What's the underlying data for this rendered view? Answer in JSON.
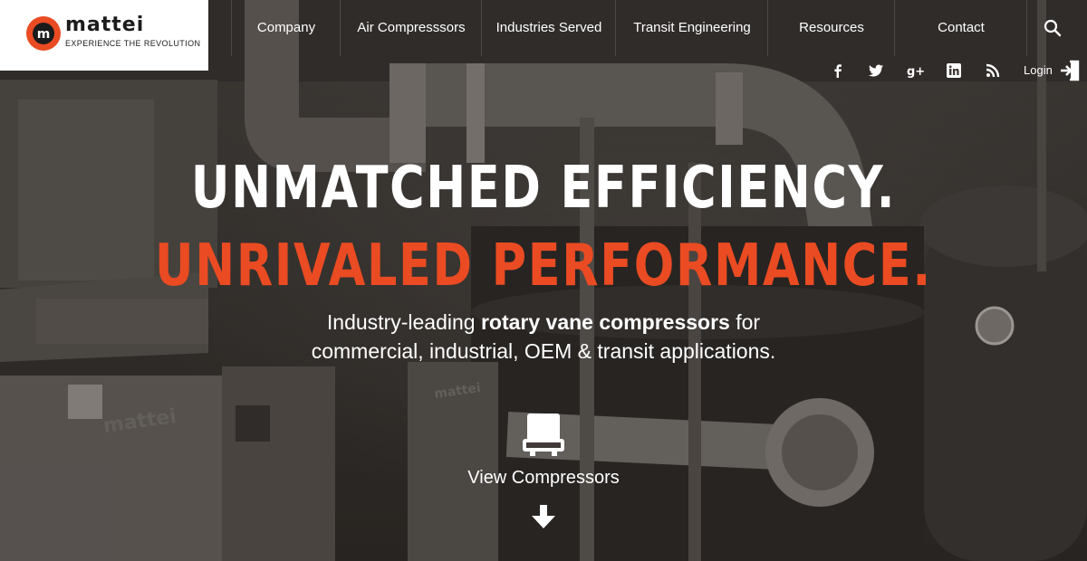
{
  "logo": {
    "wordmark": "mattei",
    "tagline": "EXPERIENCE THE REVOLUTION",
    "brand_color": "#ea4b22"
  },
  "nav": {
    "items": [
      {
        "label": "Company"
      },
      {
        "label": "Air Compresssors"
      },
      {
        "label": "Industries Served"
      },
      {
        "label": "Transit Engineering"
      },
      {
        "label": "Resources"
      },
      {
        "label": "Contact"
      }
    ],
    "search_icon": "search-icon"
  },
  "social": {
    "icons": [
      "facebook-icon",
      "twitter-icon",
      "google-plus-icon",
      "linkedin-icon",
      "rss-icon"
    ],
    "login_label": "Login",
    "login_icon": "login-icon"
  },
  "hero": {
    "headline_1": "UNMATCHED EFFICIENCY.",
    "headline_2": "UNRIVALED PERFORMANCE.",
    "sub_line_1_pre": "Industry-leading ",
    "sub_line_1_bold": "rotary vane compressors",
    "sub_line_1_post": " for",
    "sub_line_2": "commercial, industrial, OEM & transit applications.",
    "cta_label": "View Compressors",
    "cta_icon": "compressor-icon",
    "cta_arrow": "arrow-down-icon"
  },
  "colors": {
    "accent": "#ea4b22",
    "text": "#ffffff",
    "background": "#3f3a37"
  }
}
